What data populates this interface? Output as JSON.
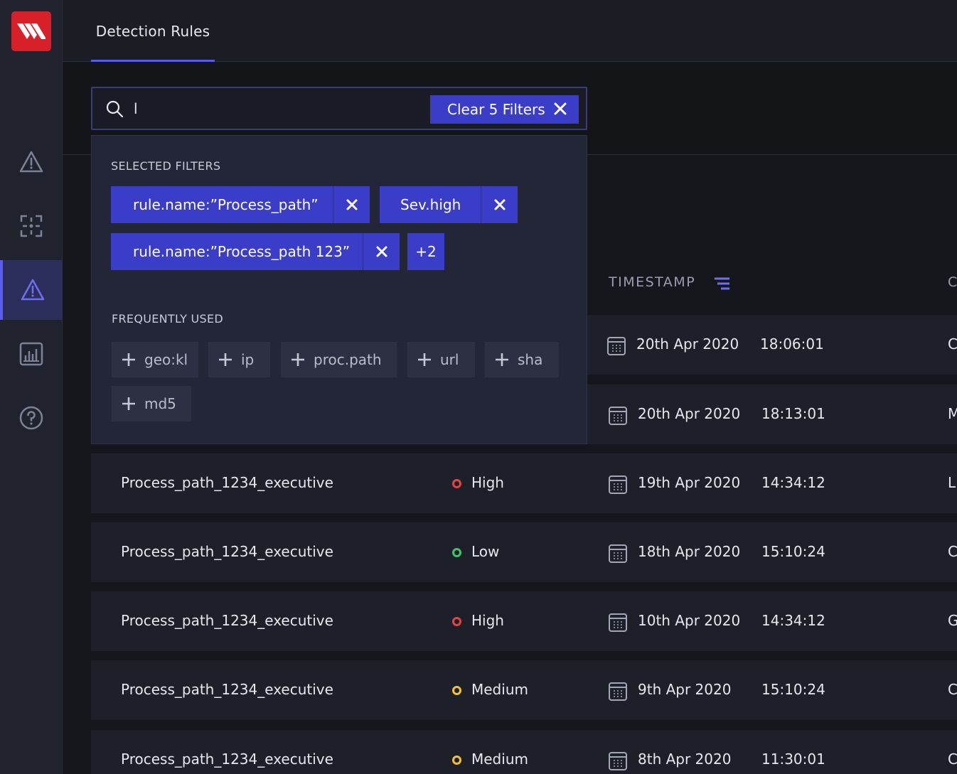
{
  "header": {
    "tab_label": "Detection Rules"
  },
  "search": {
    "value": "l",
    "clear_label": "Clear 5 Filters"
  },
  "panel": {
    "selected_title": "SELECTED FILTERS",
    "selected_filters": [
      "rule.name:”Process_path”",
      "Sev.high",
      "rule.name:”Process_path 123”"
    ],
    "more_label": "+2",
    "frequent_title": "FREQUENTLY USED",
    "frequent": [
      "geo:kl",
      "ip",
      "proc.path",
      "url",
      "sha",
      "md5"
    ]
  },
  "table": {
    "headers": {
      "timestamp": "TIMESTAMP",
      "next": "C"
    },
    "rows": [
      {
        "name": "",
        "severity": "",
        "date": "20th Apr 2020",
        "time": "18:06:01",
        "extra": "C"
      },
      {
        "name": "",
        "severity": "",
        "date": "20th Apr 2020",
        "time": "18:13:01",
        "extra": "M"
      },
      {
        "name": "Process_path_1234_executive",
        "severity": "High",
        "date": "19th Apr 2020",
        "time": "14:34:12",
        "extra": "L"
      },
      {
        "name": "Process_path_1234_executive",
        "severity": "Low",
        "date": "18th Apr 2020",
        "time": "15:10:24",
        "extra": "C"
      },
      {
        "name": "Process_path_1234_executive",
        "severity": "High",
        "date": "10th Apr 2020",
        "time": "14:34:12",
        "extra": "G"
      },
      {
        "name": "Process_path_1234_executive",
        "severity": "Medium",
        "date": "9th Apr 2020",
        "time": "15:10:24",
        "extra": "C"
      },
      {
        "name": "Process_path_1234_executive",
        "severity": "Medium",
        "date": "8th Apr 2020",
        "time": "11:30:01",
        "extra": "C"
      }
    ]
  },
  "colors": {
    "accent": "#5a5cf0",
    "chip": "#3a3dc8",
    "high": "#e04545",
    "low": "#3ec46d",
    "medium": "#f2c230",
    "brand": "#d72027"
  }
}
